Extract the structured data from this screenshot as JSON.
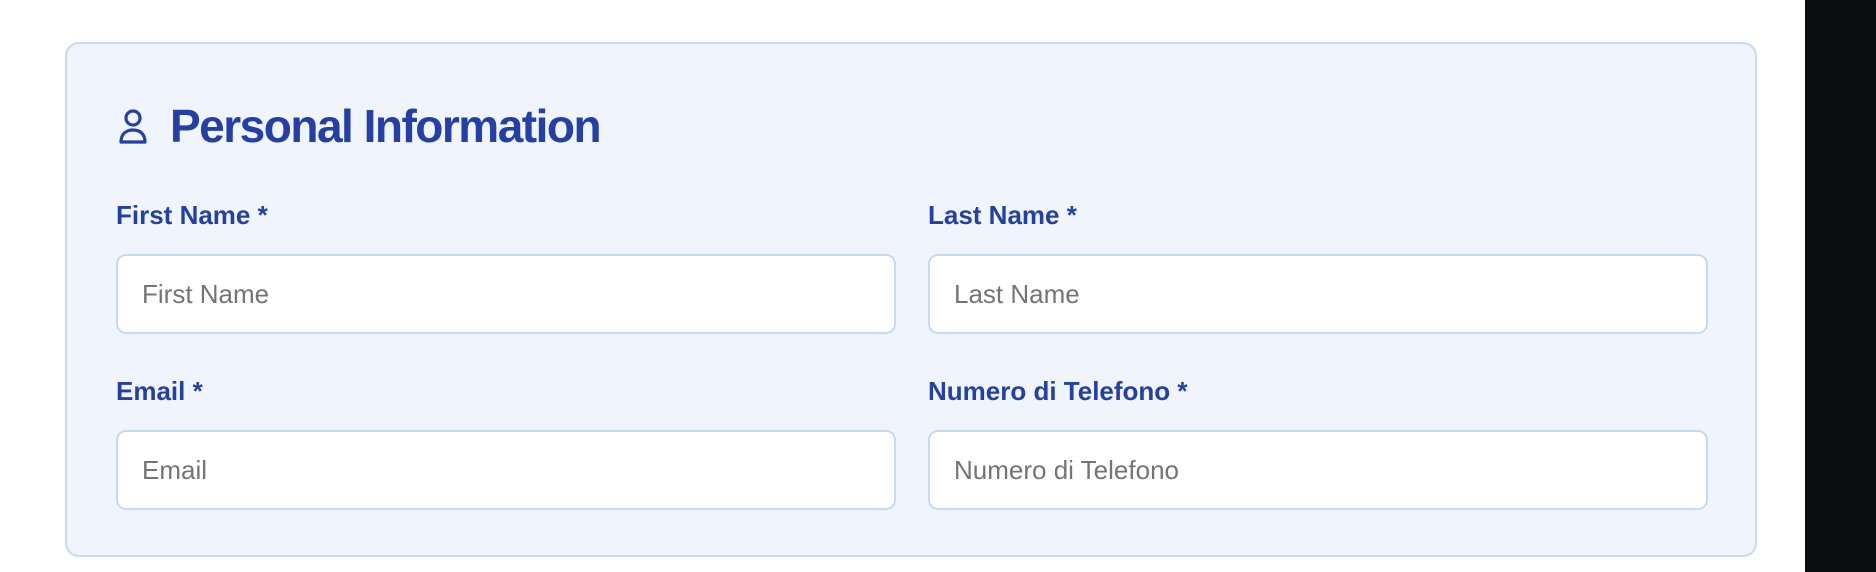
{
  "section": {
    "title": "Personal Information",
    "icon": "user-icon",
    "accent_color": "#2440a6",
    "card_background": "#eff4fd",
    "border_color": "#c6daf4"
  },
  "fields": {
    "first_name": {
      "label": "First Name *",
      "placeholder": "First Name",
      "value": ""
    },
    "last_name": {
      "label": "Last Name *",
      "placeholder": "Last Name",
      "value": ""
    },
    "email": {
      "label": "Email *",
      "placeholder": "Email",
      "value": ""
    },
    "phone": {
      "label": "Numero di Telefono *",
      "placeholder": "Numero di Telefono",
      "value": ""
    }
  }
}
